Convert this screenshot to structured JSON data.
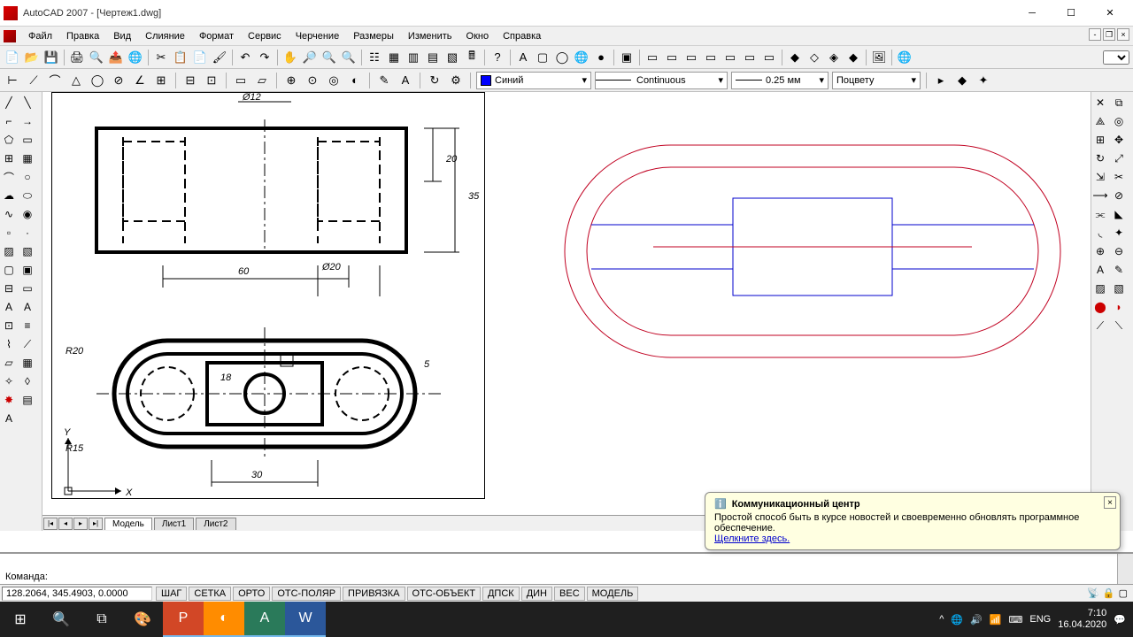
{
  "title": "AutoCAD 2007 - [Чертеж1.dwg]",
  "menu": [
    "Файл",
    "Правка",
    "Вид",
    "Слияние",
    "Формат",
    "Сервис",
    "Черчение",
    "Размеры",
    "Изменить",
    "Окно",
    "Справка"
  ],
  "props": {
    "color": "Синий",
    "linetype": "Continuous",
    "lineweight": "0.25 мм",
    "plotstyle": "Поцвету"
  },
  "tabs": {
    "model": "Модель",
    "sheet1": "Лист1",
    "sheet2": "Лист2"
  },
  "command": {
    "prompt": "Команда:"
  },
  "status": {
    "coords": "128.2064, 345.4903, 0.0000",
    "buttons": [
      "ШАГ",
      "СЕТКА",
      "ОРТО",
      "ОТС-ПОЛЯР",
      "ПРИВЯЗКА",
      "ОТС-ОБЪЕКТ",
      "ДПСК",
      "ДИН",
      "ВЕС",
      "МОДЕЛЬ"
    ]
  },
  "notif": {
    "title": "Коммуникационный центр",
    "body": "Простой способ быть в курсе новостей и своевременно обновлять программное обеспечение.",
    "link": "Щелкните здесь."
  },
  "tray": {
    "lang": "ENG",
    "time": "7:10",
    "date": "16.04.2020"
  },
  "drawing_dims": {
    "d1": "Ø12",
    "d2": "20",
    "d3": "35",
    "d4": "60",
    "d5": "Ø20",
    "d6": "R20",
    "d7": "18",
    "d8": "5",
    "d9": "R15",
    "d10": "30"
  },
  "axes": {
    "x": "X",
    "y": "Y"
  }
}
